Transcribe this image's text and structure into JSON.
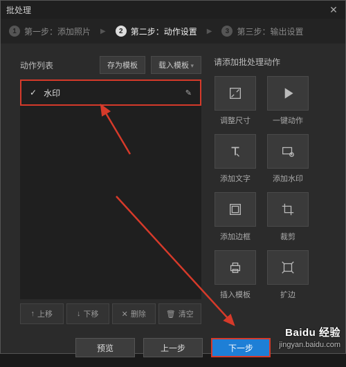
{
  "title": "批处理",
  "steps": {
    "s1": "第一步：添加照片",
    "s2": "第二步：动作设置",
    "s3": "第三步：输出设置"
  },
  "left": {
    "label": "动作列表",
    "saveTpl": "存为模板",
    "loadTpl": "载入模板",
    "item": "水印",
    "up": "上移",
    "down": "下移",
    "del": "删除",
    "clear": "清空"
  },
  "right": {
    "title": "请添加批处理动作",
    "resize": "调整尺寸",
    "oneclick": "一键动作",
    "text": "添加文字",
    "watermark": "添加水印",
    "border": "添加边框",
    "crop": "裁剪",
    "template": "插入模板",
    "expand": "扩边"
  },
  "footer": {
    "preview": "预览",
    "prev": "上一步",
    "next": "下一步"
  },
  "wm": {
    "brand": "Baidu 经验",
    "url": "jingyan.baidu.com"
  }
}
